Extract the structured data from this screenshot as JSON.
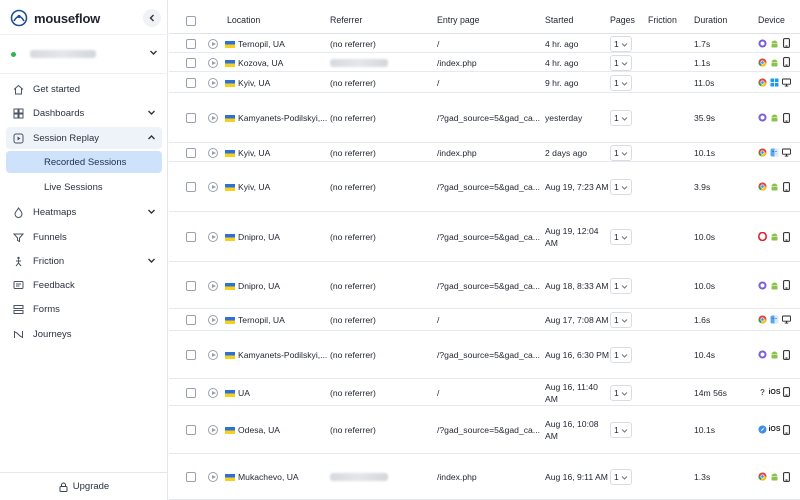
{
  "brand": {
    "name": "mouseflow"
  },
  "sidebar": {
    "workspace_status_color": "#2fb45a",
    "nav": [
      {
        "label": "Get started",
        "icon": "home-icon"
      },
      {
        "label": "Dashboards",
        "icon": "dashboard-icon",
        "chevron": "down"
      },
      {
        "label": "Session Replay",
        "icon": "play-square-icon",
        "chevron": "up"
      },
      {
        "label": "Heatmaps",
        "icon": "flame-icon",
        "chevron": "down"
      },
      {
        "label": "Funnels",
        "icon": "funnel-icon"
      },
      {
        "label": "Friction",
        "icon": "friction-icon",
        "chevron": "down"
      },
      {
        "label": "Feedback",
        "icon": "feedback-icon"
      },
      {
        "label": "Forms",
        "icon": "forms-icon"
      },
      {
        "label": "Journeys",
        "icon": "journeys-icon"
      }
    ],
    "sub": [
      {
        "label": "Recorded Sessions",
        "active": true
      },
      {
        "label": "Live Sessions",
        "active": false
      }
    ],
    "upgrade_label": "Upgrade"
  },
  "table": {
    "headers": {
      "location": "Location",
      "referrer": "Referrer",
      "entry": "Entry page",
      "started": "Started",
      "pages": "Pages",
      "friction": "Friction",
      "duration": "Duration",
      "device": "Device"
    },
    "rows": [
      {
        "location": "Ternopil, UA",
        "referrer": "(no referrer)",
        "entry": "/",
        "started": "4 hr. ago",
        "pages": "1",
        "duration": "1.7s",
        "devices": [
          "firefox-icon",
          "android-icon",
          "phone-icon"
        ]
      },
      {
        "location": "Kozova, UA",
        "referrer": "",
        "entry": "/index.php",
        "started": "4 hr. ago",
        "pages": "1",
        "duration": "1.1s",
        "devices": [
          "chrome-icon",
          "android-icon",
          "phone-icon"
        ]
      },
      {
        "location": "Kyiv, UA",
        "referrer": "(no referrer)",
        "entry": "/",
        "started": "9 hr. ago",
        "pages": "1",
        "duration": "11.0s",
        "devices": [
          "chrome-icon",
          "windows-icon",
          "desktop-icon"
        ]
      },
      {
        "location": "Kamyanets-Podilskyi,...",
        "referrer": "(no referrer)",
        "entry": "/?gad_source=5&gad_ca...",
        "started": "yesterday",
        "pages": "1",
        "duration": "35.9s",
        "devices": [
          "firefox-icon",
          "android-icon",
          "phone-icon"
        ]
      },
      {
        "location": "Kyiv, UA",
        "referrer": "(no referrer)",
        "entry": "/index.php",
        "started": "2 days ago",
        "pages": "1",
        "duration": "10.1s",
        "devices": [
          "chrome-icon",
          "finder-icon",
          "desktop-icon"
        ]
      },
      {
        "location": "Kyiv, UA",
        "referrer": "(no referrer)",
        "entry": "/?gad_source=5&gad_ca...",
        "started": "Aug 19, 7:23 AM",
        "pages": "1",
        "duration": "3.9s",
        "devices": [
          "chrome-icon",
          "android-icon",
          "phone-icon"
        ]
      },
      {
        "location": "Dnipro, UA",
        "referrer": "(no referrer)",
        "entry": "/?gad_source=5&gad_ca...",
        "started": "Aug 19, 12:04 AM",
        "pages": "1",
        "duration": "10.0s",
        "devices": [
          "opera-icon",
          "android-icon",
          "phone-icon"
        ]
      },
      {
        "location": "Dnipro, UA",
        "referrer": "(no referrer)",
        "entry": "/?gad_source=5&gad_ca...",
        "started": "Aug 18, 8:33 AM",
        "pages": "1",
        "duration": "10.0s",
        "devices": [
          "firefox-icon",
          "android-icon",
          "phone-icon"
        ]
      },
      {
        "location": "Ternopil, UA",
        "referrer": "(no referrer)",
        "entry": "/",
        "started": "Aug 17, 7:08 AM",
        "pages": "1",
        "duration": "1.6s",
        "devices": [
          "chrome-icon",
          "finder-icon",
          "desktop-icon"
        ]
      },
      {
        "location": "Kamyanets-Podilskyi,...",
        "referrer": "(no referrer)",
        "entry": "/?gad_source=5&gad_ca...",
        "started": "Aug 16, 6:30 PM",
        "pages": "1",
        "duration": "10.4s",
        "devices": [
          "firefox-icon",
          "android-icon",
          "phone-icon"
        ]
      },
      {
        "location": "UA",
        "referrer": "(no referrer)",
        "entry": "/",
        "started": "Aug 16, 11:40 AM",
        "pages": "1",
        "duration": "14m 56s",
        "devices": [
          "unknown-icon",
          "ios-icon",
          "phone-icon"
        ]
      },
      {
        "location": "Odesa, UA",
        "referrer": "(no referrer)",
        "entry": "/?gad_source=5&gad_ca...",
        "started": "Aug 16, 10:08 AM",
        "pages": "1",
        "duration": "10.1s",
        "devices": [
          "safari-icon",
          "ios-icon",
          "phone-icon"
        ]
      },
      {
        "location": "Mukachevo, UA",
        "referrer": "",
        "entry": "/index.php",
        "started": "Aug 16, 9:11 AM",
        "pages": "1",
        "duration": "1.3s",
        "devices": [
          "chrome-icon",
          "android-icon",
          "phone-icon"
        ]
      }
    ]
  }
}
